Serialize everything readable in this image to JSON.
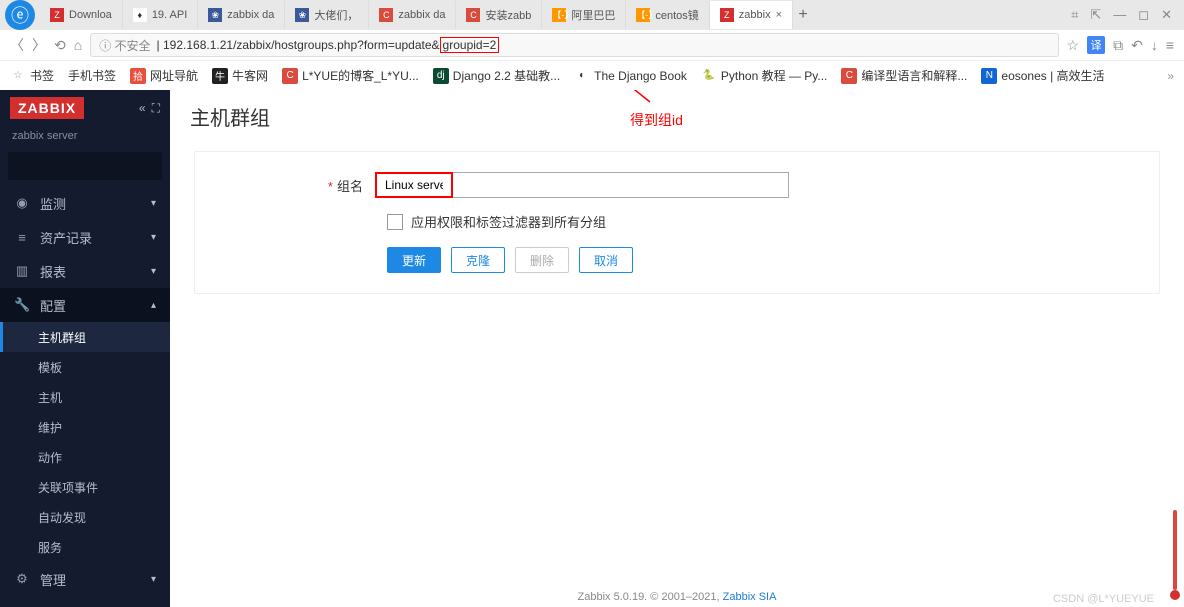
{
  "browser": {
    "tabs": [
      {
        "label": "Downloa",
        "fav": "Z",
        "favbg": "#d32f2f"
      },
      {
        "label": "19. API",
        "fav": "♦",
        "favbg": "#fff"
      },
      {
        "label": "zabbix da",
        "fav": "❀",
        "favbg": "#3b5998"
      },
      {
        "label": "大佬们，",
        "fav": "❀",
        "favbg": "#3b5998"
      },
      {
        "label": "zabbix da",
        "fav": "C",
        "favbg": "#d94b3d"
      },
      {
        "label": "安装zabb",
        "fav": "C",
        "favbg": "#d94b3d"
      },
      {
        "label": "阿里巴巴",
        "fav": "【-】",
        "favbg": "#ff9800"
      },
      {
        "label": "centos镜",
        "fav": "【-】",
        "favbg": "#ff9800"
      },
      {
        "label": "zabbix",
        "fav": "Z",
        "favbg": "#d32f2f",
        "active": true
      }
    ],
    "url_insecure": "ⓘ 不安全",
    "url_plain": "192.168.1.21/zabbix/hostgroups.php?form=update&",
    "url_hl": "groupid=2",
    "bookmarks": [
      {
        "icon": "☆",
        "label": "书签",
        "bg": "transparent",
        "fg": "#999"
      },
      {
        "icon": "",
        "label": "手机书签",
        "bg": "",
        "fg": "#333"
      },
      {
        "icon": "拾",
        "label": "网址导航",
        "bg": "#ec4e3d",
        "fg": "#fff"
      },
      {
        "icon": "牛",
        "label": "牛客网",
        "bg": "#222",
        "fg": "#fff"
      },
      {
        "icon": "C",
        "label": "L*YUE的博客_L*YU...",
        "bg": "#d94b3d",
        "fg": "#fff"
      },
      {
        "icon": "dj",
        "label": "Django 2.2 基础教...",
        "bg": "#0c4b33",
        "fg": "#fff"
      },
      {
        "icon": "◐",
        "label": "The Django Book",
        "bg": "#fff",
        "fg": "#333"
      },
      {
        "icon": "🐍",
        "label": "Python 教程 — Py...",
        "bg": "#fff",
        "fg": "#333"
      },
      {
        "icon": "C",
        "label": "编译型语言和解释...",
        "bg": "#d94b3d",
        "fg": "#fff"
      },
      {
        "icon": "N",
        "label": "eosones | 高效生活",
        "bg": "#1166d6",
        "fg": "#fff"
      }
    ]
  },
  "sidebar": {
    "logo": "ZABBIX",
    "server": "zabbix server",
    "items": [
      {
        "icon": "◉",
        "label": "监测",
        "chev": "▾"
      },
      {
        "icon": "≡",
        "label": "资产记录",
        "chev": "▾"
      },
      {
        "icon": "▥",
        "label": "报表",
        "chev": "▾"
      },
      {
        "icon": "🔧",
        "label": "配置",
        "chev": "▴",
        "expanded": true,
        "subs": [
          {
            "label": "主机群组",
            "active": true
          },
          {
            "label": "模板"
          },
          {
            "label": "主机"
          },
          {
            "label": "维护"
          },
          {
            "label": "动作"
          },
          {
            "label": "关联项事件"
          },
          {
            "label": "自动发现"
          },
          {
            "label": "服务"
          }
        ]
      },
      {
        "icon": "⚙",
        "label": "管理",
        "chev": "▾"
      }
    ]
  },
  "page": {
    "title": "主机群组",
    "annotation": "得到组id",
    "form": {
      "name_label": "组名",
      "name_value": "Linux servers",
      "checkbox_label": "应用权限和标签过滤器到所有分组",
      "btn_update": "更新",
      "btn_clone": "克隆",
      "btn_delete": "删除",
      "btn_cancel": "取消"
    },
    "footer_text": "Zabbix 5.0.19. © 2001–2021, ",
    "footer_link": "Zabbix SIA",
    "watermark": "CSDN @L*YUEYUE"
  }
}
